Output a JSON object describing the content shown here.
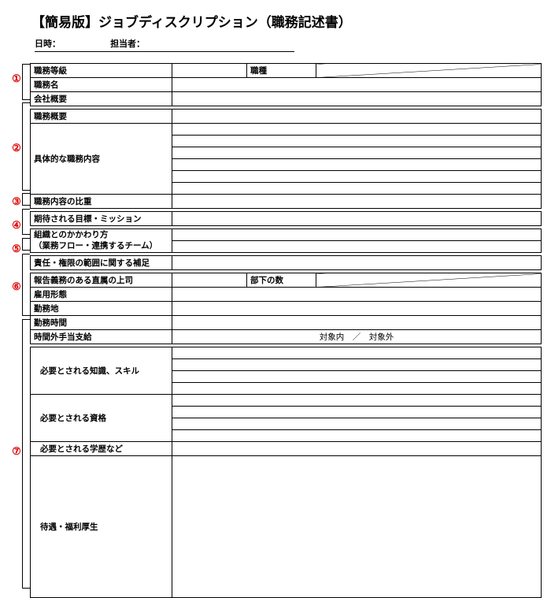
{
  "title": "【簡易版】ジョブディスクリプション（職務記述書）",
  "meta": {
    "date_label": "日時：",
    "person_label": "担当者："
  },
  "markers": [
    "①",
    "②",
    "③",
    "④",
    "⑤",
    "⑥",
    "⑦"
  ],
  "rows": {
    "grade": "職務等級",
    "type": "職種",
    "name": "職務名",
    "company": "会社概要",
    "overview": "職務概要",
    "detail": "具体的な職務内容",
    "weight": "職務内容の比重",
    "mission": "期待される目標・ミッション",
    "relation": "組織とのかかわり方",
    "relation_sub": "（業務フロー・連携するチーム）",
    "authority": "責任・権限の範囲に関する補足",
    "boss": "報告義務のある直属の上司",
    "subordinates": "部下の数",
    "employment": "雇用形態",
    "location": "勤務地",
    "hours": "勤務時間",
    "overtime": "時間外手当支給",
    "overtime_vals": "対象内　／　対象外",
    "knowledge": "必要とされる知識、スキル",
    "qualification": "必要とされる資格",
    "education": "必要とされる学歴など",
    "welfare": "待遇・福利厚生"
  }
}
